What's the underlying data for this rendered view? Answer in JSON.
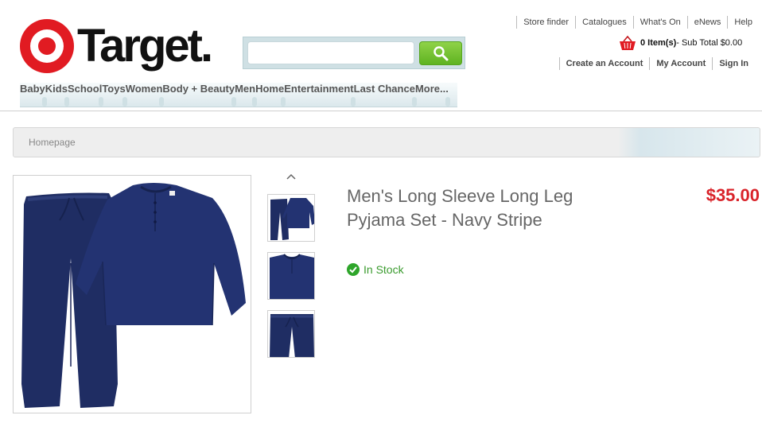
{
  "header": {
    "brand_name": "Target.",
    "search": {
      "value": "",
      "placeholder": ""
    },
    "utility_links": [
      "Store finder",
      "Catalogues",
      "What's On",
      "eNews",
      "Help"
    ],
    "cart": {
      "items": "0 Item(s)",
      "subtotal": " - Sub Total $0.00"
    },
    "account_links": [
      "Create an Account",
      "My Account",
      "Sign In"
    ]
  },
  "categories": [
    "Baby",
    "Kids",
    "School",
    "Toys",
    "Women",
    "Body + Beauty",
    "Men",
    "Home",
    "Entertainment",
    "Last Chance",
    "More..."
  ],
  "breadcrumb": {
    "home": "Homepage"
  },
  "product": {
    "title": "Men's Long Sleeve Long Leg Pyjama Set - Navy Stripe",
    "stock": "In Stock",
    "price": "$35.00"
  },
  "colors": {
    "brand_red": "#e11b22",
    "price_red": "#d9232a",
    "stock_green": "#3a9b2e",
    "search_green": "#6bbd2b",
    "garment_navy": "#1f2d63"
  },
  "icons": [
    "bullseye-logo",
    "magnifier-icon",
    "shopping-basket-icon",
    "chevron-up-icon",
    "check-circle-icon"
  ]
}
